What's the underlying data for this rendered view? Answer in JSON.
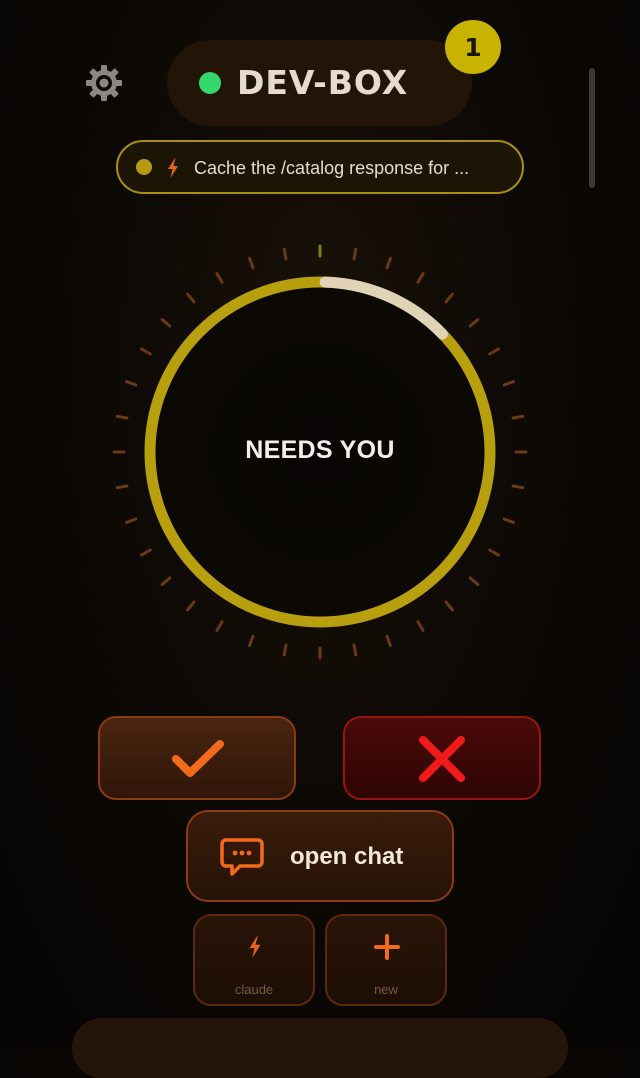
{
  "header": {
    "settings_icon": "gear-icon",
    "machine_name": "DEV-BOX",
    "status_color": "#33d86a",
    "notification_count": "1",
    "scrollbar": "vertical"
  },
  "task": {
    "text": "Cache the /catalog response for ...",
    "dot_color": "#b89a12",
    "icon": "bolt-icon"
  },
  "dial": {
    "status": "NEEDS YOU",
    "ring_color": "#b79f0d",
    "progress_color": "#e0d3b6",
    "progress_fraction": 0.08
  },
  "actions": {
    "approve_icon": "check-icon",
    "reject_icon": "x-icon",
    "chat_label": "open chat",
    "chat_icon": "chat-bubble-icon",
    "shortcuts": [
      {
        "label": "claude",
        "icon": "bolt-icon"
      },
      {
        "label": "new",
        "icon": "plus-icon"
      }
    ]
  }
}
